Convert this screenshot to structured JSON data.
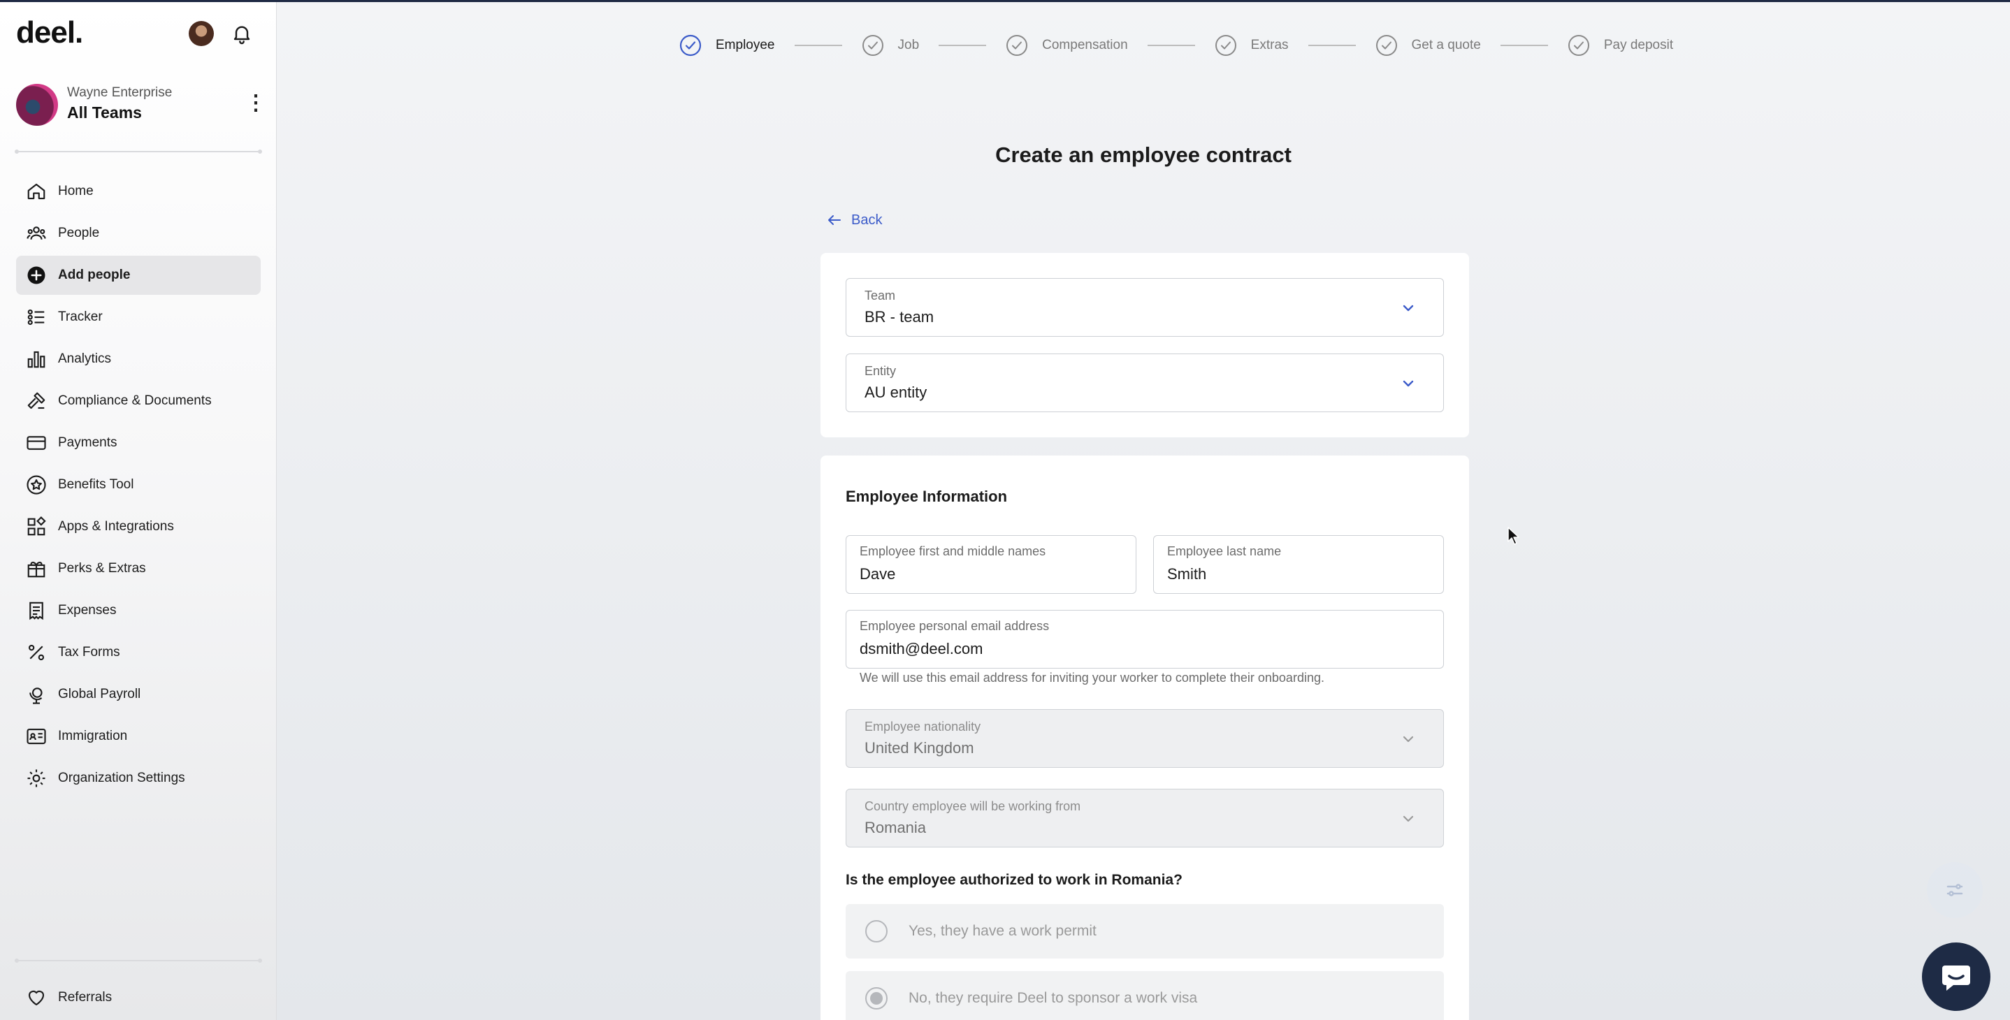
{
  "app": {
    "logo": "deel.",
    "org_subtitle": "Wayne Enterprise",
    "org_name": "All Teams"
  },
  "sidebar": {
    "items": [
      {
        "label": "Home",
        "icon": "home-icon"
      },
      {
        "label": "People",
        "icon": "people-icon"
      },
      {
        "label": "Add people",
        "icon": "plus-circle-icon",
        "active": true
      },
      {
        "label": "Tracker",
        "icon": "tracker-icon"
      },
      {
        "label": "Analytics",
        "icon": "bar-chart-icon"
      },
      {
        "label": "Compliance & Documents",
        "icon": "gavel-icon"
      },
      {
        "label": "Payments",
        "icon": "credit-card-icon"
      },
      {
        "label": "Benefits Tool",
        "icon": "star-badge-icon"
      },
      {
        "label": "Apps & Integrations",
        "icon": "apps-grid-icon"
      },
      {
        "label": "Perks & Extras",
        "icon": "gift-icon"
      },
      {
        "label": "Expenses",
        "icon": "receipt-icon"
      },
      {
        "label": "Tax Forms",
        "icon": "percent-icon"
      },
      {
        "label": "Global Payroll",
        "icon": "globe-pin-icon"
      },
      {
        "label": "Immigration",
        "icon": "id-card-icon"
      },
      {
        "label": "Organization Settings",
        "icon": "gear-icon"
      }
    ],
    "referrals": "Referrals"
  },
  "stepper": {
    "steps": [
      {
        "label": "Employee",
        "current": true
      },
      {
        "label": "Job"
      },
      {
        "label": "Compensation"
      },
      {
        "label": "Extras"
      },
      {
        "label": "Get a quote"
      },
      {
        "label": "Pay deposit"
      }
    ]
  },
  "page": {
    "title": "Create an employee contract",
    "back": "Back"
  },
  "team_entity": {
    "team_label": "Team",
    "team_value": "BR - team",
    "entity_label": "Entity",
    "entity_value": "AU entity"
  },
  "employee_info": {
    "title": "Employee Information",
    "first_name_label": "Employee first and middle names",
    "first_name_value": "Dave",
    "last_name_label": "Employee last name",
    "last_name_value": "Smith",
    "email_label": "Employee personal email address",
    "email_value": "dsmith@deel.com",
    "email_hint": "We will use this email address for inviting your worker to complete their onboarding.",
    "nationality_label": "Employee nationality",
    "nationality_value": "United Kingdom",
    "work_country_label": "Country employee will be working from",
    "work_country_value": "Romania",
    "auth_question": "Is the employee authorized to work in Romania?",
    "auth_options": [
      {
        "label": "Yes, they have a work permit",
        "checked": false
      },
      {
        "label": "No, they require Deel to sponsor a work visa",
        "checked": true
      }
    ]
  },
  "colors": {
    "accent": "#3b5bc9",
    "nav_active_bg": "#e6e6e8",
    "chat_fab": "#1e2b45"
  }
}
